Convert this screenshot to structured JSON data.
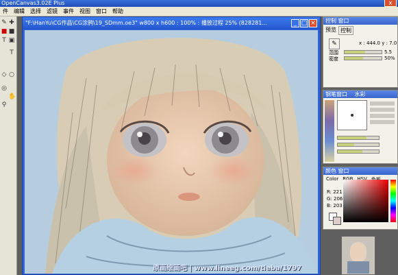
{
  "app": {
    "title": "OpenCanvas3.02E Plus",
    "close_label": "x"
  },
  "menu": [
    "件",
    "编辑",
    "选择",
    "滤镜",
    "事件",
    "视图",
    "窗口",
    "帮助"
  ],
  "tools": [
    "✎",
    "✚",
    "■",
    "■",
    "T",
    "▣",
    "T",
    "◇",
    "○",
    "◎",
    "✋",
    "⚲"
  ],
  "document": {
    "title": "\"F:\\HanYu\\CG作品\\CG涂鸦\\19_SDmm.oe3\"  w800 x h600 : 100% : 播放过程 25% (828281...",
    "min_label": "_",
    "max_label": "□",
    "close_label": "×"
  },
  "caption": "原画绘画吧 | www.lineeg.com/tieba/1797",
  "control_panel": {
    "title": "控制  窗口",
    "tab_preview": "预览",
    "tab_control": "控制",
    "coords": "x : 444.0  y : 7.0",
    "range_label": "范围",
    "range_value": "5.5",
    "range_fraction": 0.55,
    "density_label": "密度",
    "density_value": "50%",
    "density_fraction": 0.5
  },
  "brush_panel": {
    "title": "钢笔窗口",
    "tab": "水彩"
  },
  "color_panel": {
    "title": "颜色  窗口",
    "tabs": [
      "Color",
      "RGB",
      "HSV",
      "色板"
    ],
    "r_label": "R: 221",
    "g_label": "G: 206",
    "b_label": "B: 203",
    "current_color": "#ddcecb"
  },
  "colors": {
    "desktop": "#5f5f5f",
    "title_blue": "#2456cc",
    "canvas_bg": "#b6cde0"
  }
}
